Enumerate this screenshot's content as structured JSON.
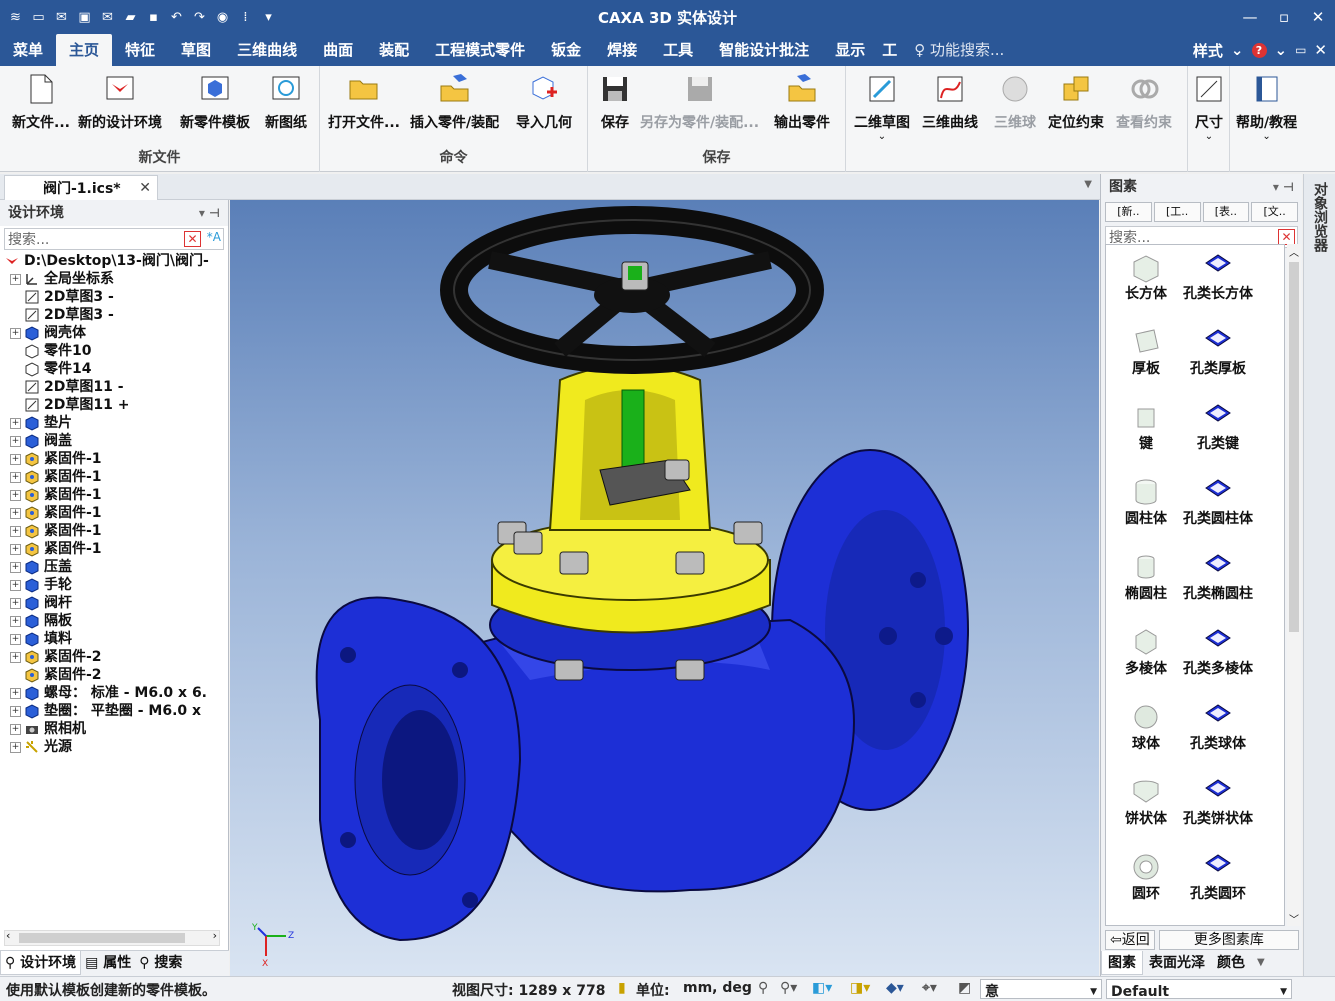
{
  "app": {
    "title": "CAXA 3D 实体设计"
  },
  "colors": {
    "titlebar": "#2b5797",
    "valve_body": "#1d2fd6",
    "bonnet": "#f0ea1e",
    "handwheel": "#111111",
    "stem": "#1ab01a"
  },
  "menu": {
    "items": [
      "菜单",
      "主页",
      "特征",
      "草图",
      "三维曲线",
      "曲面",
      "装配",
      "工程模式零件",
      "钣金",
      "焊接",
      "工具",
      "智能设计批注",
      "显示",
      "工"
    ],
    "active": "主页",
    "search_placeholder": "功能搜索...",
    "style_label": "样式"
  },
  "ribbon": {
    "groups": [
      {
        "label": "新文件",
        "buttons": [
          "新文件...",
          "新的设计环境",
          "新零件模板",
          "新图纸"
        ]
      },
      {
        "label": "命令",
        "buttons": [
          "打开文件...",
          "插入零件/装配",
          "导入几何"
        ]
      },
      {
        "label": "保存",
        "buttons": [
          "保存",
          "另存为零件/装配...",
          "输出零件"
        ]
      },
      {
        "label": "",
        "buttons": [
          "二维草图",
          "三维曲线",
          "三维球",
          "定位约束",
          "查看约束"
        ]
      },
      {
        "label": "",
        "buttons": [
          "尺寸"
        ]
      },
      {
        "label": "",
        "buttons": [
          "帮助/教程"
        ]
      }
    ]
  },
  "document_tab": {
    "label": "阀门-1.ics*"
  },
  "left_panel": {
    "title": "设计环境",
    "search_placeholder": "搜索...",
    "tree": [
      {
        "label": "D:\\Desktop\\13-阀门\\阀门-",
        "icon": "root-icon",
        "expand": false,
        "indent": 0
      },
      {
        "label": "全局坐标系",
        "icon": "axis-icon",
        "expand": true,
        "indent": 1
      },
      {
        "label": "2D草图3 -",
        "icon": "sketch-icon",
        "expand": false,
        "indent": 1
      },
      {
        "label": "2D草图3 -",
        "icon": "sketch-icon",
        "expand": false,
        "indent": 1
      },
      {
        "label": "阀壳体",
        "icon": "part-icon",
        "expand": true,
        "indent": 1
      },
      {
        "label": "零件10",
        "icon": "part-outline-icon",
        "expand": false,
        "indent": 1
      },
      {
        "label": "零件14",
        "icon": "part-outline-icon",
        "expand": false,
        "indent": 1
      },
      {
        "label": "2D草图11 -",
        "icon": "sketch-icon",
        "expand": false,
        "indent": 1
      },
      {
        "label": "2D草图11 +",
        "icon": "sketch-icon",
        "expand": false,
        "indent": 1
      },
      {
        "label": "垫片",
        "icon": "part-icon",
        "expand": true,
        "indent": 1
      },
      {
        "label": "阀盖",
        "icon": "part-icon",
        "expand": true,
        "indent": 1
      },
      {
        "label": "紧固件-1",
        "icon": "fastener-icon",
        "expand": true,
        "indent": 1
      },
      {
        "label": "紧固件-1",
        "icon": "fastener-icon",
        "expand": true,
        "indent": 1
      },
      {
        "label": "紧固件-1",
        "icon": "fastener-icon",
        "expand": true,
        "indent": 1
      },
      {
        "label": "紧固件-1",
        "icon": "fastener-icon",
        "expand": true,
        "indent": 1
      },
      {
        "label": "紧固件-1",
        "icon": "fastener-icon",
        "expand": true,
        "indent": 1
      },
      {
        "label": "紧固件-1",
        "icon": "fastener-icon",
        "expand": true,
        "indent": 1
      },
      {
        "label": "压盖",
        "icon": "part-icon",
        "expand": true,
        "indent": 1
      },
      {
        "label": "手轮",
        "icon": "part-icon",
        "expand": true,
        "indent": 1
      },
      {
        "label": "阀杆",
        "icon": "part-icon",
        "expand": true,
        "indent": 1
      },
      {
        "label": "隔板",
        "icon": "part-icon",
        "expand": true,
        "indent": 1
      },
      {
        "label": "填料",
        "icon": "part-icon",
        "expand": true,
        "indent": 1
      },
      {
        "label": "紧固件-2",
        "icon": "fastener-icon",
        "expand": true,
        "indent": 1
      },
      {
        "label": "紧固件-2",
        "icon": "fastener-icon",
        "expand": false,
        "indent": 1
      },
      {
        "label": "螺母： 标准 - M6.0 x 6.",
        "icon": "part-icon",
        "expand": true,
        "indent": 1
      },
      {
        "label": "垫圈： 平垫圈 - M6.0 x",
        "icon": "part-icon",
        "expand": true,
        "indent": 1
      },
      {
        "label": "照相机",
        "icon": "camera-icon",
        "expand": true,
        "indent": 1
      },
      {
        "label": "光源",
        "icon": "light-icon",
        "expand": true,
        "indent": 1
      }
    ],
    "tabs": [
      "设计环境",
      "属性",
      "搜索"
    ]
  },
  "viewport": {
    "axis_labels": {
      "x": "X",
      "y": "Y",
      "z": "Z"
    }
  },
  "right_panel": {
    "title": "图素",
    "tabs": [
      "[新..",
      "[工..",
      "[表..",
      "[文.."
    ],
    "search_placeholder": "搜索...",
    "items": [
      [
        "长方体",
        "孔类长方体"
      ],
      [
        "厚板",
        "孔类厚板"
      ],
      [
        "键",
        "孔类键"
      ],
      [
        "圆柱体",
        "孔类圆柱体"
      ],
      [
        "椭圆柱",
        "孔类椭圆柱"
      ],
      [
        "多棱体",
        "孔类多棱体"
      ],
      [
        "球体",
        "孔类球体"
      ],
      [
        "饼状体",
        "孔类饼状体"
      ],
      [
        "圆环",
        "孔类圆环"
      ]
    ],
    "back_label": "返回",
    "more_label": "更多图素库",
    "bottom_tabs": [
      "图素",
      "表面光泽",
      "颜色"
    ]
  },
  "side_tab": {
    "label": "对象浏览器"
  },
  "status": {
    "message": "使用默认模板创建新的零件模板。",
    "view_size": "视图尺寸: 1289 x 778",
    "unit_label": "单位:",
    "unit_value": "mm, deg",
    "combo1": "意",
    "combo2": "Default"
  }
}
